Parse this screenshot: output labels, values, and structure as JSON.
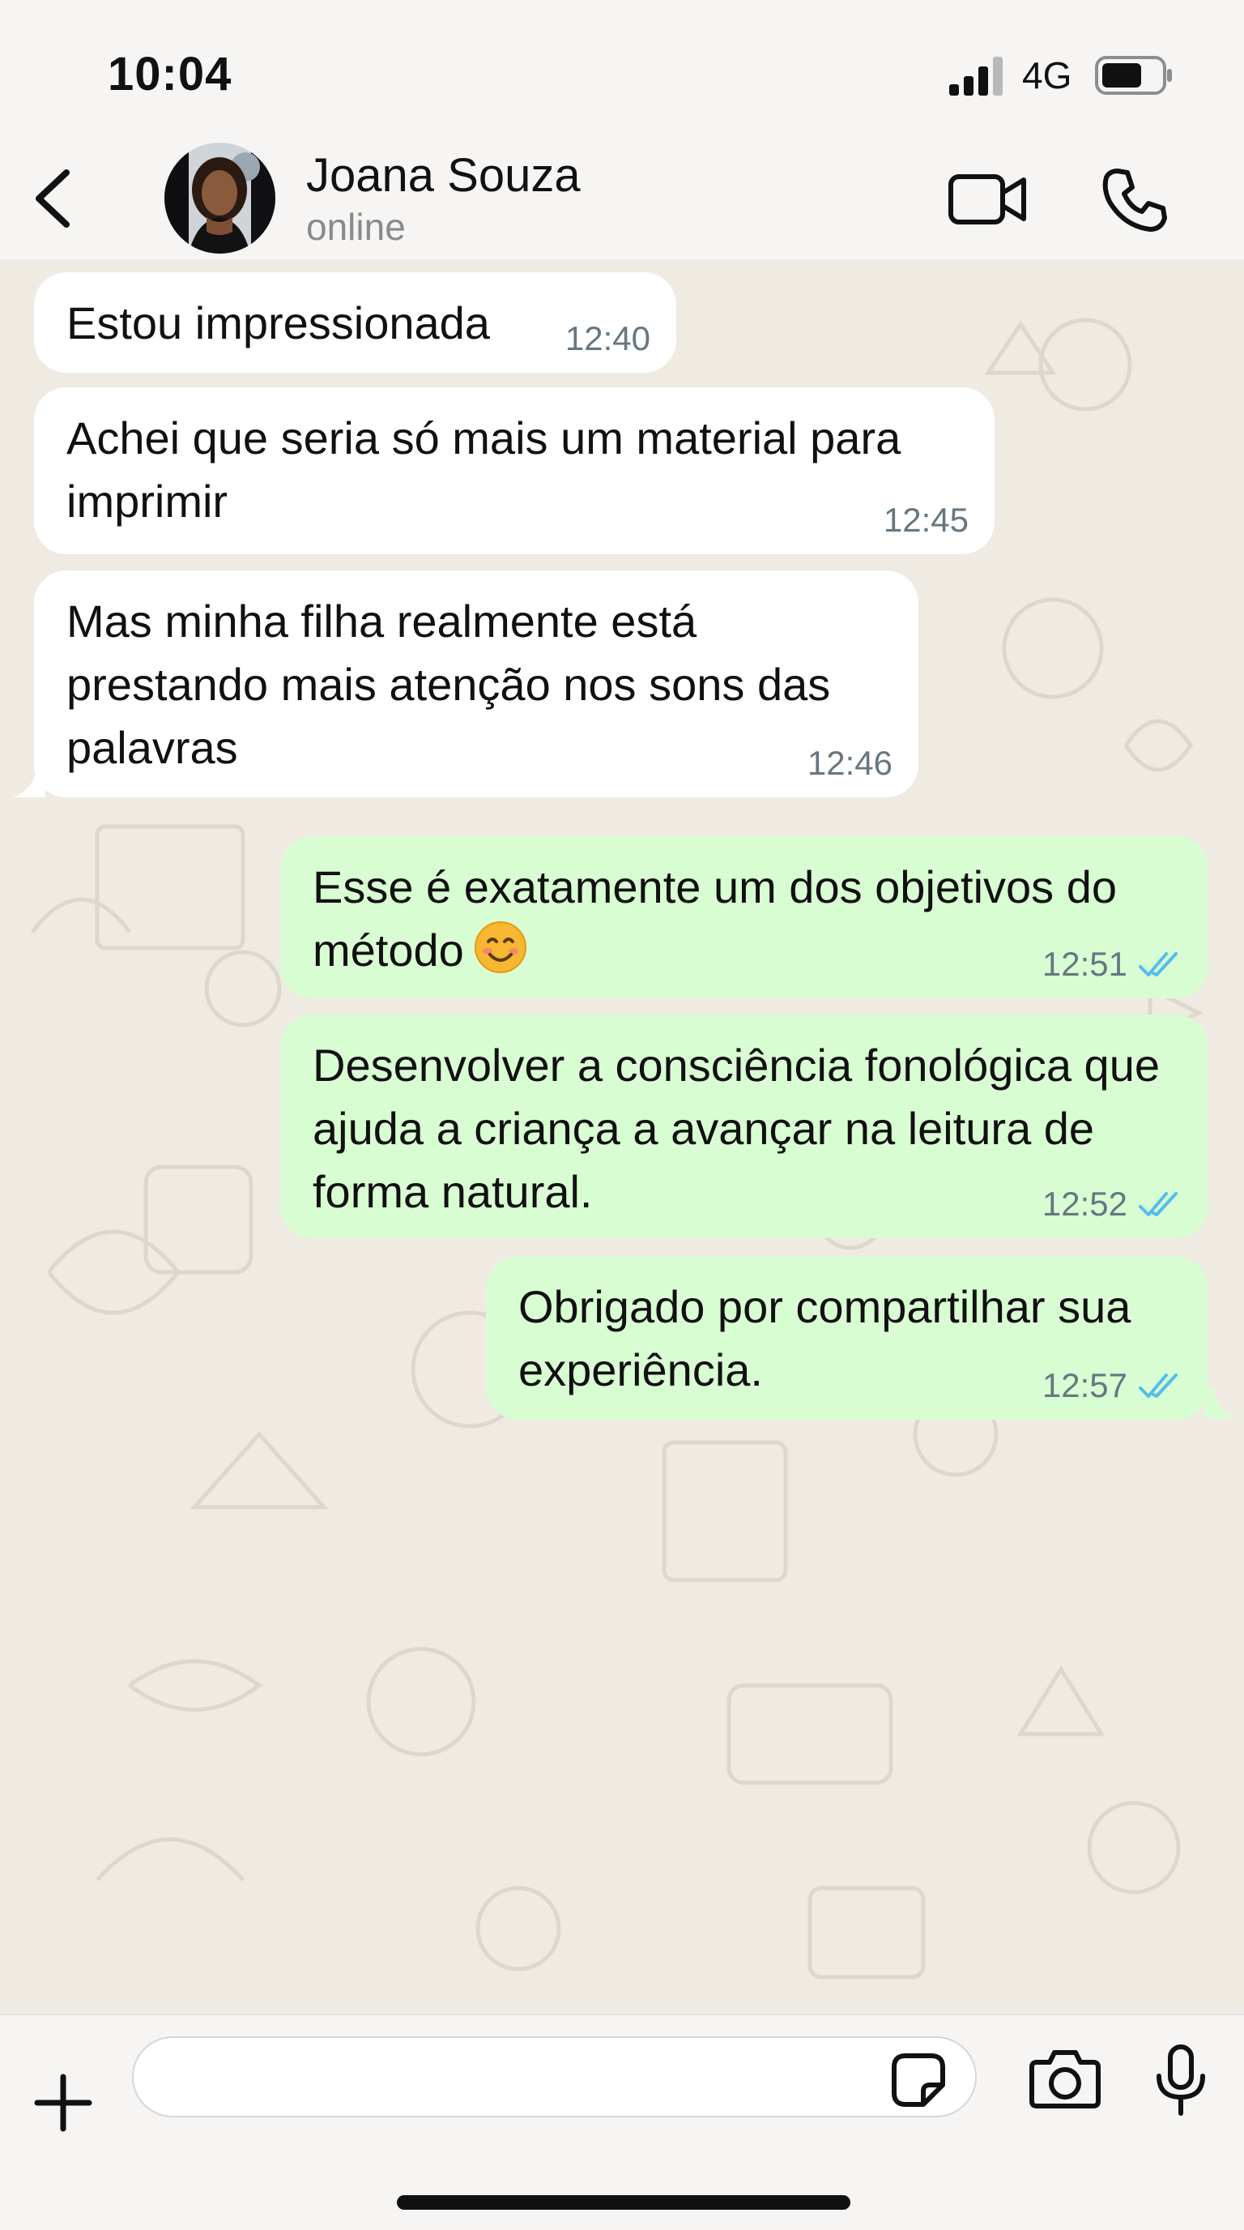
{
  "status_bar": {
    "time": "10:04",
    "network": "4G",
    "signal_icon": "signal-bars-icon",
    "battery_icon": "battery-icon"
  },
  "header": {
    "contact_name": "Joana Souza",
    "contact_status": "online",
    "back_icon": "chevron-left-icon",
    "video_icon": "video-camera-icon",
    "call_icon": "phone-icon"
  },
  "messages": [
    {
      "direction": "in",
      "text": "Estou impressionada",
      "time": "12:40"
    },
    {
      "direction": "in",
      "text": "Achei que seria só mais um material para imprimir",
      "time": "12:45"
    },
    {
      "direction": "in",
      "text": "Mas minha filha realmente está prestando mais atenção nos sons das palavras",
      "time": "12:46"
    },
    {
      "direction": "out",
      "text": "Esse é exatamente um dos objetivos do método",
      "emoji": "smiling-face-icon",
      "time": "12:51",
      "read": true
    },
    {
      "direction": "out",
      "text": "Desenvolver a consciência fonológica que ajuda a criança a avançar na leitura de forma natural.",
      "time": "12:52",
      "read": true
    },
    {
      "direction": "out",
      "text": "Obrigado por compartilhar sua experiência.",
      "time": "12:57",
      "read": true
    }
  ],
  "composer": {
    "input_value": "",
    "plus_icon": "plus-icon",
    "sticker_icon": "sticker-icon",
    "camera_icon": "camera-icon",
    "mic_icon": "microphone-icon"
  },
  "colors": {
    "incoming_bubble": "#ffffff",
    "outgoing_bubble": "#d9fdd3",
    "chat_background": "#efeae2",
    "read_ticks": "#53bdeb",
    "timestamp": "#667781"
  }
}
